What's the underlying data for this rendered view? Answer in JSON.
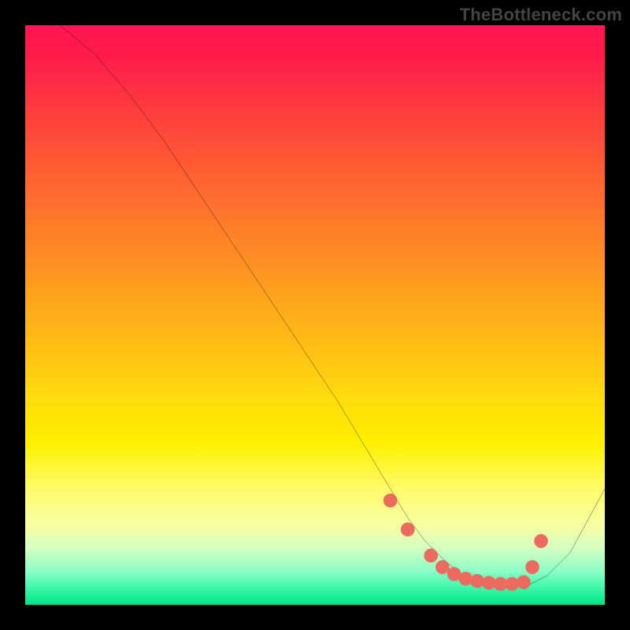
{
  "watermark": "TheBottleneck.com",
  "chart_data": {
    "type": "line",
    "title": "",
    "xlabel": "",
    "ylabel": "",
    "xlim": [
      0,
      100
    ],
    "ylim": [
      0,
      100
    ],
    "grid": false,
    "series": [
      {
        "name": "curve",
        "x": [
          6,
          12,
          18,
          24,
          30,
          36,
          42,
          48,
          54,
          60,
          63,
          66,
          69,
          72,
          75,
          78,
          81,
          84,
          87,
          90,
          94,
          100
        ],
        "y": [
          100,
          95,
          88,
          80,
          71,
          62,
          53,
          44,
          35,
          25,
          20,
          15,
          11,
          8,
          5.5,
          4,
          3.2,
          3,
          3.5,
          5,
          9,
          20
        ]
      }
    ],
    "markers": {
      "name": "curve-dots",
      "x": [
        63,
        66,
        70,
        72,
        74,
        76,
        78,
        80,
        82,
        84,
        86,
        87.5,
        89
      ],
      "y": [
        18,
        13,
        8.5,
        6.5,
        5.3,
        4.5,
        4.1,
        3.8,
        3.6,
        3.6,
        3.9,
        6.5,
        11
      ]
    }
  }
}
